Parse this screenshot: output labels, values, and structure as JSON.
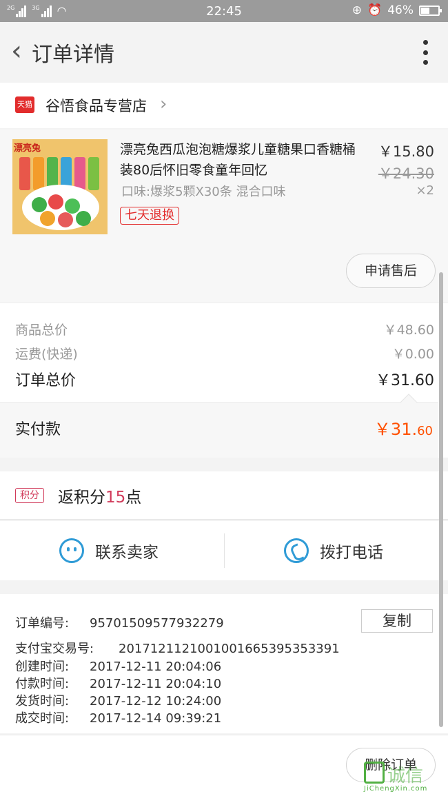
{
  "status_bar": {
    "time": "22:45",
    "net1": "2G",
    "net2": "3G",
    "battery": "46%"
  },
  "header": {
    "title": "订单详情"
  },
  "store": {
    "badge": "天猫",
    "name": "谷悟食品专营店"
  },
  "product": {
    "brand_text": "漂亮兔",
    "title": "漂亮兔西瓜泡泡糖爆浆儿童糖果口香糖桶装80后怀旧零食童年回忆",
    "spec": "口味:爆浆5颗X30条 混合口味",
    "tag": "七天退换",
    "price": "￥15.80",
    "original_price": "￥24.30",
    "qty": "×2",
    "after_sale_label": "申请售后"
  },
  "summary": {
    "goods_total_label": "商品总价",
    "goods_total_value": "￥48.60",
    "shipping_label": "运费(快递)",
    "shipping_value": "￥0.00",
    "order_total_label": "订单总价",
    "order_total_value": "￥31.60",
    "paid_label": "实付款",
    "paid_main": "￥31.",
    "paid_cents": "60"
  },
  "points": {
    "badge": "积分",
    "prefix": "返积分",
    "num": "15",
    "suffix": "点"
  },
  "contact": {
    "seller_label": "联系卖家",
    "call_label": "拨打电话"
  },
  "info": {
    "order_no_label": "订单编号:",
    "order_no": "95701509577932279",
    "copy_label": "复制",
    "alipay_label": "支付宝交易号:",
    "alipay_no": "2017121121001001665395353391",
    "created_label": "创建时间:",
    "created": "2017-12-11 20:04:06",
    "paid_label": "付款时间:",
    "paid": "2017-12-11 20:04:10",
    "shipped_label": "发货时间:",
    "shipped": "2017-12-12 10:24:00",
    "done_label": "成交时间:",
    "done": "2017-12-14 09:39:21"
  },
  "footer": {
    "delete_label": "删除订单"
  },
  "watermark": {
    "text": "诚信",
    "url": "JiChengXin.com"
  }
}
